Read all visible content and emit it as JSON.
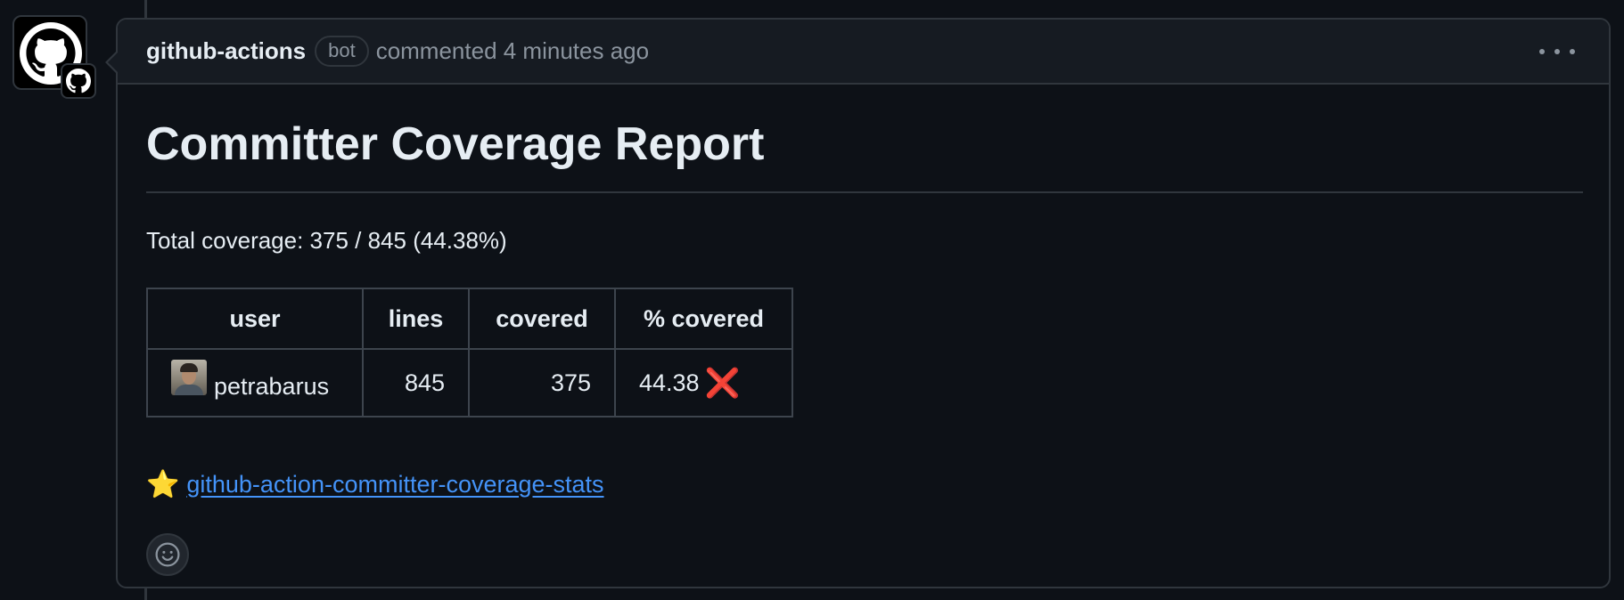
{
  "comment": {
    "author": "github-actions",
    "badge": "bot",
    "meta": "commented 4 minutes ago",
    "menu_icon": "kebab-horizontal-icon"
  },
  "report": {
    "title": "Committer Coverage Report",
    "total_coverage": "Total coverage: 375 / 845 (44.38%)",
    "table": {
      "headers": [
        "user",
        "lines",
        "covered",
        "% covered"
      ],
      "rows": [
        {
          "user": "petrabarus",
          "lines": "845",
          "covered": "375",
          "percent": "44.38",
          "status_icon": "cross-mark-icon",
          "status_glyph": "❌"
        }
      ]
    },
    "footer_link": {
      "icon": "star-icon",
      "glyph": "⭐",
      "text": "github-action-committer-coverage-stats"
    }
  },
  "colors": {
    "background": "#0d1117",
    "header_bg": "#161b22",
    "border": "#30363d",
    "link": "#4493f8",
    "muted_text": "#8b949e",
    "fail_red": "#e5322d"
  }
}
